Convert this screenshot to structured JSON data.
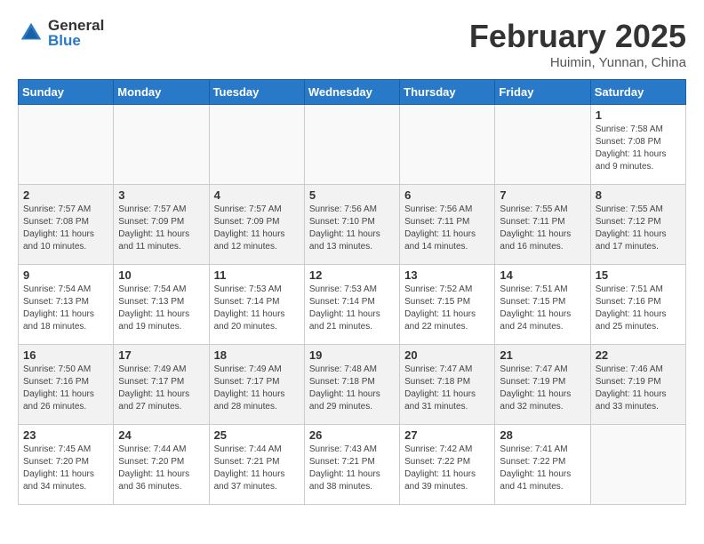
{
  "header": {
    "logo_general": "General",
    "logo_blue": "Blue",
    "month_title": "February 2025",
    "location": "Huimin, Yunnan, China"
  },
  "weekdays": [
    "Sunday",
    "Monday",
    "Tuesday",
    "Wednesday",
    "Thursday",
    "Friday",
    "Saturday"
  ],
  "weeks": [
    [
      {
        "day": "",
        "info": ""
      },
      {
        "day": "",
        "info": ""
      },
      {
        "day": "",
        "info": ""
      },
      {
        "day": "",
        "info": ""
      },
      {
        "day": "",
        "info": ""
      },
      {
        "day": "",
        "info": ""
      },
      {
        "day": "1",
        "info": "Sunrise: 7:58 AM\nSunset: 7:08 PM\nDaylight: 11 hours and 9 minutes."
      }
    ],
    [
      {
        "day": "2",
        "info": "Sunrise: 7:57 AM\nSunset: 7:08 PM\nDaylight: 11 hours and 10 minutes."
      },
      {
        "day": "3",
        "info": "Sunrise: 7:57 AM\nSunset: 7:09 PM\nDaylight: 11 hours and 11 minutes."
      },
      {
        "day": "4",
        "info": "Sunrise: 7:57 AM\nSunset: 7:09 PM\nDaylight: 11 hours and 12 minutes."
      },
      {
        "day": "5",
        "info": "Sunrise: 7:56 AM\nSunset: 7:10 PM\nDaylight: 11 hours and 13 minutes."
      },
      {
        "day": "6",
        "info": "Sunrise: 7:56 AM\nSunset: 7:11 PM\nDaylight: 11 hours and 14 minutes."
      },
      {
        "day": "7",
        "info": "Sunrise: 7:55 AM\nSunset: 7:11 PM\nDaylight: 11 hours and 16 minutes."
      },
      {
        "day": "8",
        "info": "Sunrise: 7:55 AM\nSunset: 7:12 PM\nDaylight: 11 hours and 17 minutes."
      }
    ],
    [
      {
        "day": "9",
        "info": "Sunrise: 7:54 AM\nSunset: 7:13 PM\nDaylight: 11 hours and 18 minutes."
      },
      {
        "day": "10",
        "info": "Sunrise: 7:54 AM\nSunset: 7:13 PM\nDaylight: 11 hours and 19 minutes."
      },
      {
        "day": "11",
        "info": "Sunrise: 7:53 AM\nSunset: 7:14 PM\nDaylight: 11 hours and 20 minutes."
      },
      {
        "day": "12",
        "info": "Sunrise: 7:53 AM\nSunset: 7:14 PM\nDaylight: 11 hours and 21 minutes."
      },
      {
        "day": "13",
        "info": "Sunrise: 7:52 AM\nSunset: 7:15 PM\nDaylight: 11 hours and 22 minutes."
      },
      {
        "day": "14",
        "info": "Sunrise: 7:51 AM\nSunset: 7:15 PM\nDaylight: 11 hours and 24 minutes."
      },
      {
        "day": "15",
        "info": "Sunrise: 7:51 AM\nSunset: 7:16 PM\nDaylight: 11 hours and 25 minutes."
      }
    ],
    [
      {
        "day": "16",
        "info": "Sunrise: 7:50 AM\nSunset: 7:16 PM\nDaylight: 11 hours and 26 minutes."
      },
      {
        "day": "17",
        "info": "Sunrise: 7:49 AM\nSunset: 7:17 PM\nDaylight: 11 hours and 27 minutes."
      },
      {
        "day": "18",
        "info": "Sunrise: 7:49 AM\nSunset: 7:17 PM\nDaylight: 11 hours and 28 minutes."
      },
      {
        "day": "19",
        "info": "Sunrise: 7:48 AM\nSunset: 7:18 PM\nDaylight: 11 hours and 29 minutes."
      },
      {
        "day": "20",
        "info": "Sunrise: 7:47 AM\nSunset: 7:18 PM\nDaylight: 11 hours and 31 minutes."
      },
      {
        "day": "21",
        "info": "Sunrise: 7:47 AM\nSunset: 7:19 PM\nDaylight: 11 hours and 32 minutes."
      },
      {
        "day": "22",
        "info": "Sunrise: 7:46 AM\nSunset: 7:19 PM\nDaylight: 11 hours and 33 minutes."
      }
    ],
    [
      {
        "day": "23",
        "info": "Sunrise: 7:45 AM\nSunset: 7:20 PM\nDaylight: 11 hours and 34 minutes."
      },
      {
        "day": "24",
        "info": "Sunrise: 7:44 AM\nSunset: 7:20 PM\nDaylight: 11 hours and 36 minutes."
      },
      {
        "day": "25",
        "info": "Sunrise: 7:44 AM\nSunset: 7:21 PM\nDaylight: 11 hours and 37 minutes."
      },
      {
        "day": "26",
        "info": "Sunrise: 7:43 AM\nSunset: 7:21 PM\nDaylight: 11 hours and 38 minutes."
      },
      {
        "day": "27",
        "info": "Sunrise: 7:42 AM\nSunset: 7:22 PM\nDaylight: 11 hours and 39 minutes."
      },
      {
        "day": "28",
        "info": "Sunrise: 7:41 AM\nSunset: 7:22 PM\nDaylight: 11 hours and 41 minutes."
      },
      {
        "day": "",
        "info": ""
      }
    ]
  ]
}
